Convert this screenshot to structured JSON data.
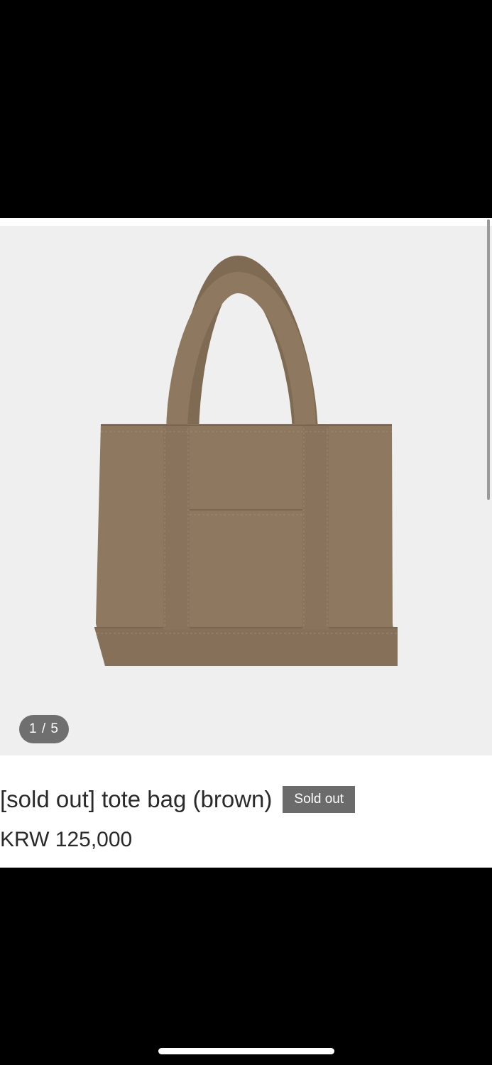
{
  "gallery": {
    "counter_text": "1 / 5",
    "image_label": "bag-photo"
  },
  "product": {
    "title": "[sold out] tote bag (brown)",
    "badge": "Sold out",
    "price": "KRW 125,000"
  },
  "colors": {
    "bag": "#8e7860",
    "gallery_bg": "#efefef",
    "badge_bg": "#6b6b6b",
    "text": "#2a2a2a"
  }
}
